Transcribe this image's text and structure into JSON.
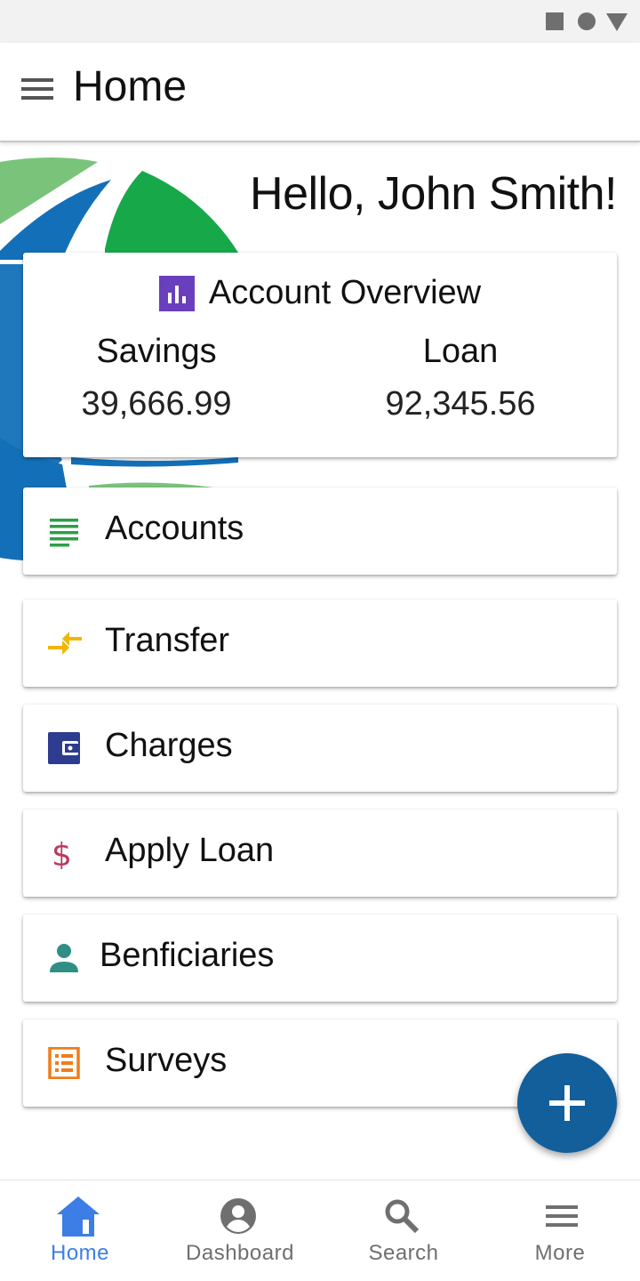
{
  "header": {
    "title": "Home"
  },
  "greeting": "Hello, John Smith!",
  "overview": {
    "title": "Account Overview",
    "savings_label": "Savings",
    "savings_value": "39,666.99",
    "loan_label": "Loan",
    "loan_value": "92,345.56"
  },
  "menu": [
    {
      "label": "Accounts",
      "icon": "list-icon",
      "color": "#2e9e48"
    },
    {
      "label": "Transfer",
      "icon": "transfer-arrows-icon",
      "color": "#f2b600"
    },
    {
      "label": "Charges",
      "icon": "wallet-icon",
      "color": "#2d3c8f"
    },
    {
      "label": "Apply Loan",
      "icon": "dollar-icon",
      "color": "#b83b5e"
    },
    {
      "label": "Benficiaries",
      "icon": "person-icon",
      "color": "#2f8f85"
    },
    {
      "label": "Surveys",
      "icon": "survey-list-icon",
      "color": "#ef7d1a"
    }
  ],
  "fab": {
    "icon": "plus-icon",
    "color": "#125f9c"
  },
  "bottom_nav": [
    {
      "label": "Home",
      "icon": "home-icon",
      "active": true
    },
    {
      "label": "Dashboard",
      "icon": "account-circle-icon",
      "active": false
    },
    {
      "label": "Search",
      "icon": "search-icon",
      "active": false
    },
    {
      "label": "More",
      "icon": "menu-icon",
      "active": false
    }
  ],
  "colors": {
    "accent": "#3d7ee6",
    "overview_icon": "#6a3fbd",
    "nav_inactive": "#6f6f6f"
  }
}
